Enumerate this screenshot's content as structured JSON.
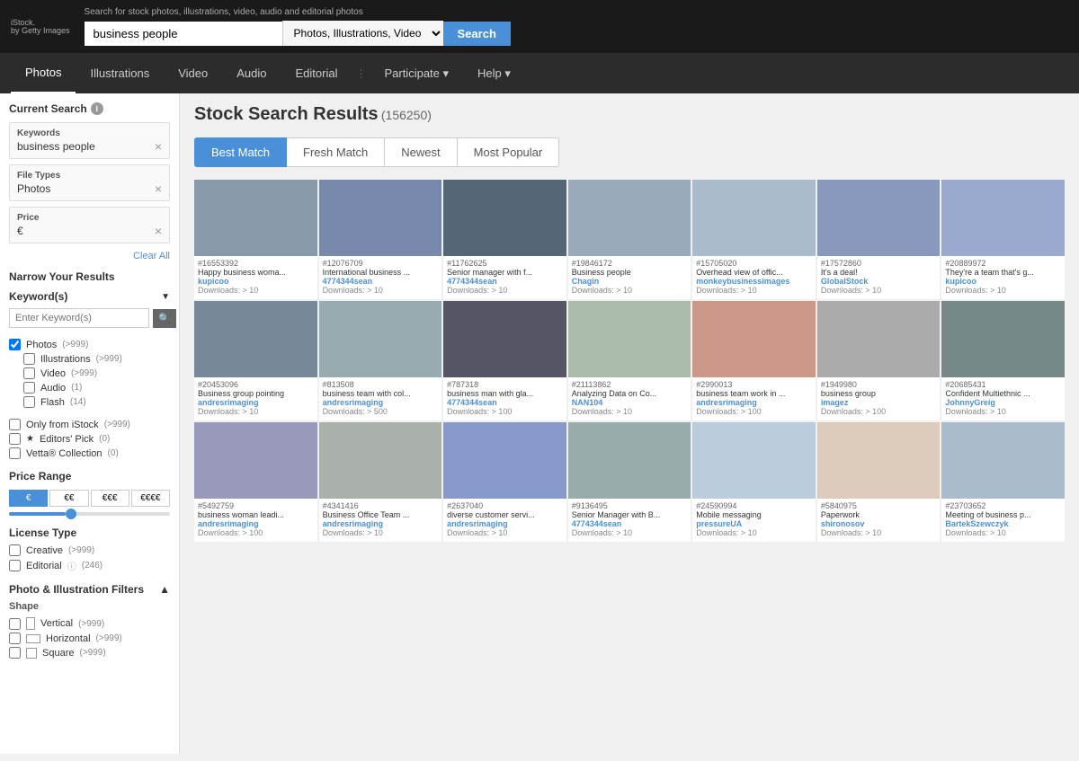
{
  "header": {
    "logo": "iStock.",
    "logo_sub": "by Getty Images",
    "hint": "Search for stock photos, illustrations, video, audio and editorial photos",
    "search_value": "business people",
    "search_type": "Photos, Illustrations, Video",
    "search_btn": "Search"
  },
  "nav": {
    "items": [
      {
        "label": "Photos",
        "active": true
      },
      {
        "label": "Illustrations",
        "active": false
      },
      {
        "label": "Video",
        "active": false
      },
      {
        "label": "Audio",
        "active": false
      },
      {
        "label": "Editorial",
        "active": false
      },
      {
        "label": "Participate",
        "active": false,
        "dropdown": true
      },
      {
        "label": "Help",
        "active": false,
        "dropdown": true
      }
    ]
  },
  "sidebar": {
    "current_search_label": "Current Search",
    "keywords_label": "Keywords",
    "keywords_value": "business people",
    "file_types_label": "File Types",
    "file_types_value": "Photos",
    "price_label": "Price",
    "price_value": "€",
    "clear_all_label": "Clear All",
    "narrow_label": "Narrow Your Results",
    "keywords_section_label": "Keyword(s)",
    "keyword_placeholder": "Enter Keyword(s)",
    "file_types_section": [
      {
        "label": "Photos",
        "count": ">999",
        "checked": true
      },
      {
        "label": "Illustrations",
        "count": ">999",
        "checked": false
      },
      {
        "label": "Video",
        "count": ">999",
        "checked": false
      },
      {
        "label": "Audio",
        "count": "1",
        "checked": false
      },
      {
        "label": "Flash",
        "count": "14",
        "checked": false
      }
    ],
    "special_filters": [
      {
        "label": "Only from iStock",
        "count": ">999",
        "checked": false
      },
      {
        "label": "Editors' Pick",
        "count": "0",
        "checked": false,
        "has_icon": true
      },
      {
        "label": "Vetta® Collection",
        "count": "0",
        "checked": false
      }
    ],
    "price_range_label": "Price Range",
    "price_buttons": [
      "€",
      "€€",
      "€€€",
      "€€€€"
    ],
    "license_type_label": "License Type",
    "license_items": [
      {
        "label": "Creative",
        "count": ">999",
        "checked": false
      },
      {
        "label": "Editorial",
        "count": "246",
        "checked": false,
        "has_icon": true
      }
    ],
    "photo_filters_label": "Photo & Illustration Filters",
    "shape_label": "Shape",
    "shape_items": [
      {
        "label": "Vertical",
        "count": ">999",
        "type": "vertical"
      },
      {
        "label": "Horizontal",
        "count": ">999",
        "type": "horizontal"
      },
      {
        "label": "Square",
        "count": ">999",
        "type": "square"
      }
    ]
  },
  "results": {
    "title": "Stock Search Results",
    "count": "(156250)",
    "sort_tabs": [
      {
        "label": "Best Match",
        "active": true
      },
      {
        "label": "Fresh Match",
        "active": false
      },
      {
        "label": "Newest",
        "active": false
      },
      {
        "label": "Most Popular",
        "active": false
      }
    ],
    "images": [
      {
        "id": "#16553392",
        "desc": "Happy business woma...",
        "author": "kupicoo",
        "downloads": "Downloads: > 10",
        "bg": "#8899aa"
      },
      {
        "id": "#12076709",
        "desc": "International business ...",
        "author": "4774344sean",
        "downloads": "Downloads: > 10",
        "bg": "#7788aa"
      },
      {
        "id": "#11762625",
        "desc": "Senior manager with f...",
        "author": "4774344sean",
        "downloads": "Downloads: > 10",
        "bg": "#556677"
      },
      {
        "id": "#19846172",
        "desc": "Business people",
        "author": "Chagin",
        "downloads": "Downloads: > 10",
        "bg": "#99aabb"
      },
      {
        "id": "#15705020",
        "desc": "Overhead view of offic...",
        "author": "monkeybusinessimages",
        "downloads": "Downloads: > 10",
        "bg": "#aabbcc"
      },
      {
        "id": "#17572860",
        "desc": "It's a deal!",
        "author": "GlobalStock",
        "downloads": "Downloads: > 10",
        "bg": "#8899bb"
      },
      {
        "id": "#20889972",
        "desc": "They're a team that's g...",
        "author": "kupicoo",
        "downloads": "Downloads: > 10",
        "bg": "#99aacc"
      },
      {
        "id": "#20453096",
        "desc": "Business group pointing",
        "author": "andresrimaging",
        "downloads": "Downloads: > 10",
        "bg": "#778899"
      },
      {
        "id": "#813508",
        "desc": "business team with col...",
        "author": "andresrimaging",
        "downloads": "Downloads: > 500",
        "bg": "#99aab0"
      },
      {
        "id": "#787318",
        "desc": "business man with gla...",
        "author": "4774344sean",
        "downloads": "Downloads: > 100",
        "bg": "#555566"
      },
      {
        "id": "#21113862",
        "desc": "Analyzing Data on Co...",
        "author": "NAN104",
        "downloads": "Downloads: > 10",
        "bg": "#aabbaa"
      },
      {
        "id": "#2990013",
        "desc": "business team work in ...",
        "author": "andresrimaging",
        "downloads": "Downloads: > 100",
        "bg": "#cc9988"
      },
      {
        "id": "#1949980",
        "desc": "business group",
        "author": "imagez",
        "downloads": "Downloads: > 100",
        "bg": "#aaaaaa"
      },
      {
        "id": "#20685431",
        "desc": "Confident Multiethnic ...",
        "author": "JohnnyGreig",
        "downloads": "Downloads: > 10",
        "bg": "#778888"
      },
      {
        "id": "#5492759",
        "desc": "business woman leadi...",
        "author": "andresrimaging",
        "downloads": "Downloads: > 100",
        "bg": "#9999bb"
      },
      {
        "id": "#4341416",
        "desc": "Business Office Team ...",
        "author": "andresrimaging",
        "downloads": "Downloads: > 10",
        "bg": "#aab0aa"
      },
      {
        "id": "#2637040",
        "desc": "diverse customer servi...",
        "author": "andresrimaging",
        "downloads": "Downloads: > 10",
        "bg": "#8899cc"
      },
      {
        "id": "#9136495",
        "desc": "Senior Manager with B...",
        "author": "4774344sean",
        "downloads": "Downloads: > 10",
        "bg": "#99aaaa"
      },
      {
        "id": "#24590994",
        "desc": "Mobile messaging",
        "author": "pressureUA",
        "downloads": "Downloads: > 10",
        "bg": "#bbccdd"
      },
      {
        "id": "#5840975",
        "desc": "Paperwork",
        "author": "shironosov",
        "downloads": "Downloads: > 10",
        "bg": "#ddccbb"
      },
      {
        "id": "#23703652",
        "desc": "Meeting of business p...",
        "author": "BartekSzewczyk",
        "downloads": "Downloads: > 10",
        "bg": "#aabbcc"
      }
    ]
  }
}
